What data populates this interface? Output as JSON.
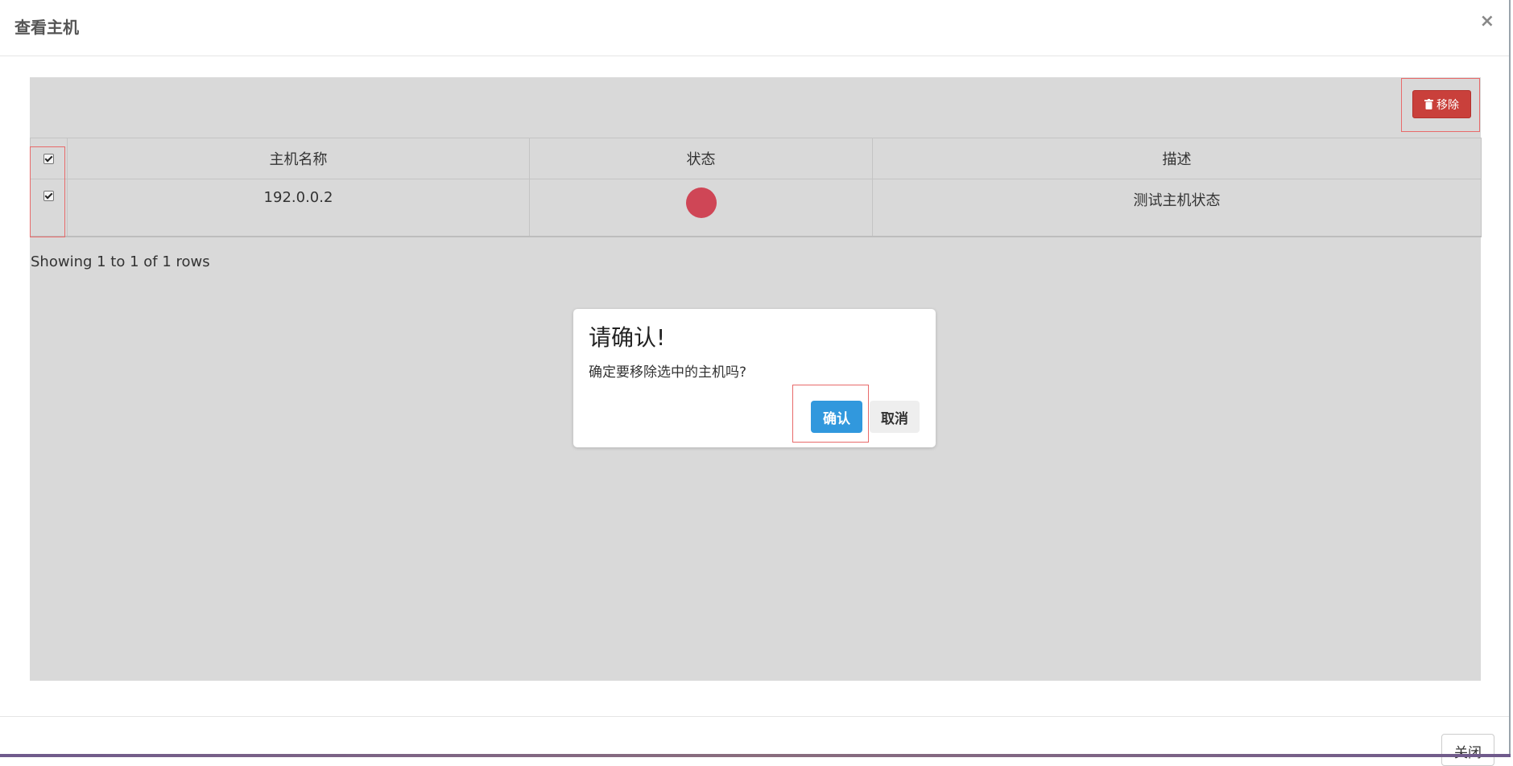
{
  "modal": {
    "title": "查看主机",
    "close_icon": "×",
    "close_button_label": "关闭"
  },
  "toolbar": {
    "remove_label": "移除",
    "remove_icon": "trash-icon",
    "remove_color": "#c9403b"
  },
  "table": {
    "columns": [
      "主机名称",
      "状态",
      "描述"
    ],
    "header_checked": true,
    "rows": [
      {
        "checked": true,
        "host_name": "192.0.0.2",
        "status_color": "#cf4656",
        "description": "测试主机状态"
      }
    ],
    "pagination_text": "Showing 1 to 1 of 1 rows"
  },
  "confirm_dialog": {
    "title": "请确认!",
    "message": "确定要移除选中的主机吗?",
    "ok_label": "确认",
    "cancel_label": "取消",
    "ok_color": "#3198dd"
  }
}
